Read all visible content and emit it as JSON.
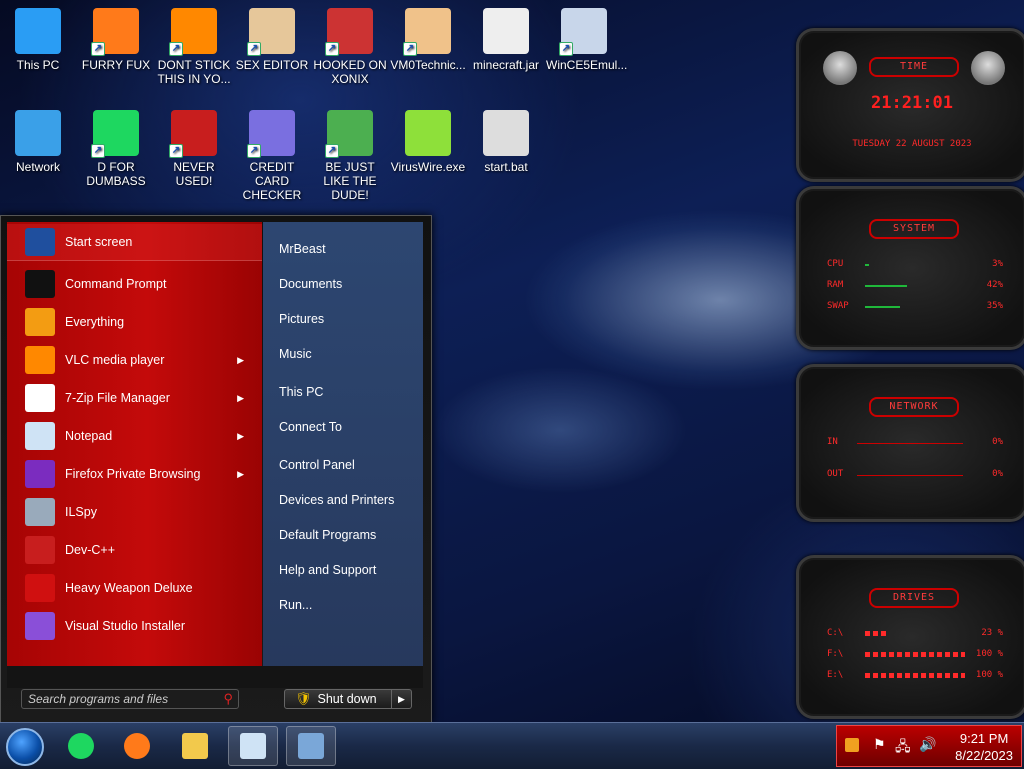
{
  "desktop": {
    "icons": [
      {
        "label": "This PC",
        "icon": "monitor-icon"
      },
      {
        "label": "FURRY FUX",
        "icon": "firefox-icon"
      },
      {
        "label": "DONT STICK THIS IN YO...",
        "icon": "vlc-cone-icon"
      },
      {
        "label": "SEX EDITOR",
        "icon": "hxd-icon"
      },
      {
        "label": "HOOKED ON XONIX",
        "icon": "xonix-game-icon"
      },
      {
        "label": "VM0Technic...",
        "icon": "doctor-avatar-icon"
      },
      {
        "label": "minecraft.jar",
        "icon": "java-icon"
      },
      {
        "label": "WinCE5Emul...",
        "icon": "wince-emulator-icon"
      },
      {
        "label": "Network",
        "icon": "network-globe-icon"
      },
      {
        "label": "D FOR DUMBASS",
        "icon": "spotify-like-icon"
      },
      {
        "label": "NEVER USED!",
        "icon": "dev-cpp-icon"
      },
      {
        "label": "CREDIT CARD CHECKER",
        "icon": "credit-card-icon"
      },
      {
        "label": "BE JUST LIKE THE DUDE!",
        "icon": "elf-icon"
      },
      {
        "label": "VirusWire.exe",
        "icon": "lime-icon"
      },
      {
        "label": "start.bat",
        "icon": "batch-gears-icon"
      }
    ]
  },
  "start_menu": {
    "programs": [
      {
        "label": "Start screen",
        "icon": "start-screen-icon",
        "has_arrow": false
      },
      {
        "label": "Command Prompt",
        "icon": "cmd-icon",
        "has_arrow": false
      },
      {
        "label": "Everything",
        "icon": "magnifier-icon",
        "has_arrow": false
      },
      {
        "label": "VLC media player",
        "icon": "vlc-cone-icon",
        "has_arrow": true
      },
      {
        "label": "7-Zip File Manager",
        "icon": "7zip-icon",
        "has_arrow": true
      },
      {
        "label": "Notepad",
        "icon": "notepad-icon",
        "has_arrow": true
      },
      {
        "label": "Firefox Private Browsing",
        "icon": "firefox-private-icon",
        "has_arrow": true
      },
      {
        "label": "ILSpy",
        "icon": "ilspy-icon",
        "has_arrow": false
      },
      {
        "label": "Dev-C++",
        "icon": "dev-cpp-icon",
        "has_arrow": false
      },
      {
        "label": "Heavy Weapon Deluxe",
        "icon": "radiation-icon",
        "has_arrow": false
      },
      {
        "label": "Visual Studio Installer",
        "icon": "vs-installer-icon",
        "has_arrow": false
      }
    ],
    "places": [
      "MrBeast",
      "Documents",
      "Pictures",
      "Music",
      "This PC",
      "Connect To",
      "Control Panel",
      "Devices and Printers",
      "Default Programs",
      "Help and Support",
      "Run..."
    ],
    "search_placeholder": "Search programs and files",
    "shutdown_label": "Shut down",
    "arrow_glyph": "▶",
    "shield_glyph": "🛡"
  },
  "gadgets": {
    "time": {
      "title": "TIME",
      "clock": "21:21:01",
      "date": "TUESDAY 22 AUGUST 2023"
    },
    "system": {
      "title": "SYSTEM",
      "rows": [
        {
          "label": "CPU",
          "value": "3%",
          "fill": 0.03
        },
        {
          "label": "RAM",
          "value": "42%",
          "fill": 0.42
        },
        {
          "label": "SWAP",
          "value": "35%",
          "fill": 0.35
        }
      ]
    },
    "network": {
      "title": "NETWORK",
      "rows": [
        {
          "label": "IN",
          "value": "0%"
        },
        {
          "label": "OUT",
          "value": "0%"
        }
      ]
    },
    "drives": {
      "title": "DRIVES",
      "rows": [
        {
          "label": "C:\\",
          "value": "23 %",
          "fill": 0.23
        },
        {
          "label": "F:\\",
          "value": "100 %",
          "fill": 1.0
        },
        {
          "label": "E:\\",
          "value": "100 %",
          "fill": 1.0
        }
      ]
    }
  },
  "taskbar": {
    "pinned": [
      {
        "name": "spotify-like-icon",
        "active": false
      },
      {
        "name": "firefox-icon",
        "active": false
      },
      {
        "name": "file-explorer-icon",
        "active": false
      },
      {
        "name": "notepad-icon",
        "active": true
      },
      {
        "name": "installer-icon",
        "active": true
      }
    ],
    "clock_time": "9:21 PM",
    "clock_date": "8/22/2023"
  },
  "colors": {
    "accent_red": "#c40a0a",
    "gadget_red": "#ff2a2a",
    "taskbar_blue": "#1a2947"
  }
}
